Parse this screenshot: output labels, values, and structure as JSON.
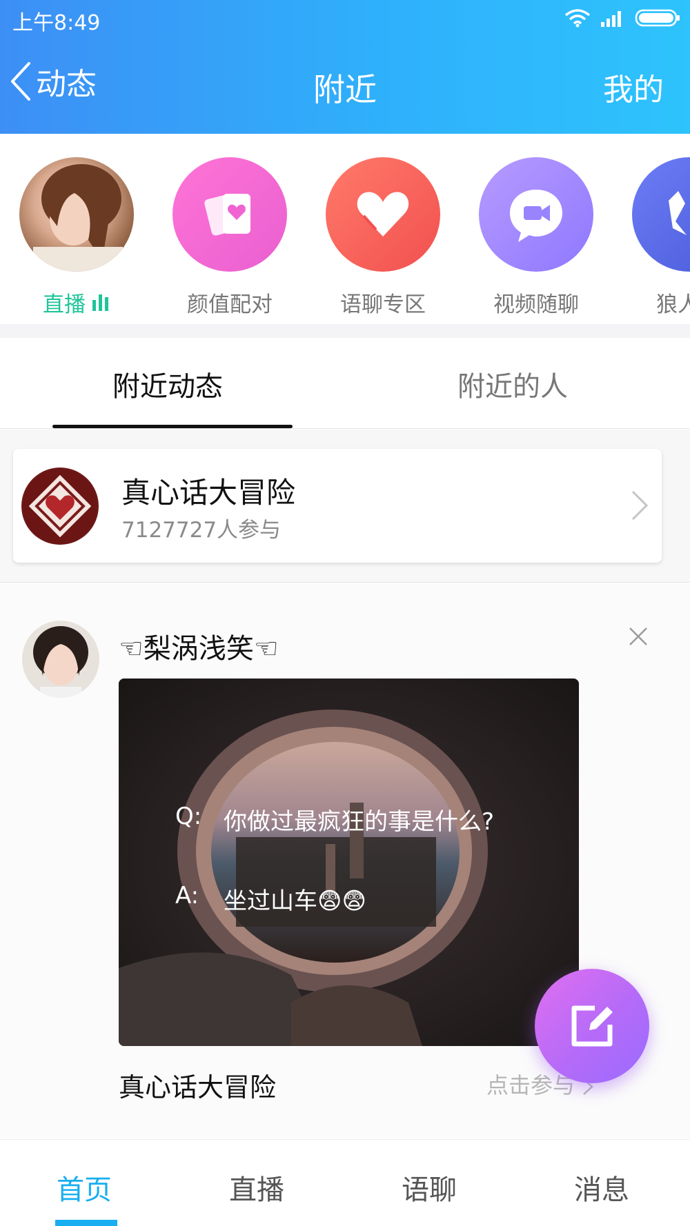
{
  "status_bar": {
    "time": "上午8:49"
  },
  "nav": {
    "back_label": "动态",
    "title": "附近",
    "right_label": "我的"
  },
  "categories": [
    {
      "label": "直播",
      "active": true
    },
    {
      "label": "颜值配对"
    },
    {
      "label": "语聊专区"
    },
    {
      "label": "视频随聊"
    },
    {
      "label": "狼人"
    }
  ],
  "tabs": [
    {
      "label": "附近动态",
      "active": true
    },
    {
      "label": "附近的人"
    }
  ],
  "topic_card": {
    "title": "真心话大冒险",
    "participants": "7127727人参与"
  },
  "post": {
    "username": "☜梨涡浅笑☜",
    "image_lines": [
      {
        "prefix": "Q:",
        "text": "你做过最疯狂的事是什么?"
      },
      {
        "prefix": "A:",
        "text": "坐过山车😨😨"
      }
    ],
    "topic_name": "真心话大冒险",
    "join_label": "点击参与"
  },
  "bottom_nav": [
    {
      "label": "首页",
      "active": true
    },
    {
      "label": "直播"
    },
    {
      "label": "语聊"
    },
    {
      "label": "消息"
    }
  ],
  "colors": {
    "header_gradient_start": "#3d8ff5",
    "header_gradient_end": "#2ec3fd",
    "live_green": "#1fc59a",
    "active_blue": "#18aef0",
    "fab_purple": "#b56bf8"
  }
}
